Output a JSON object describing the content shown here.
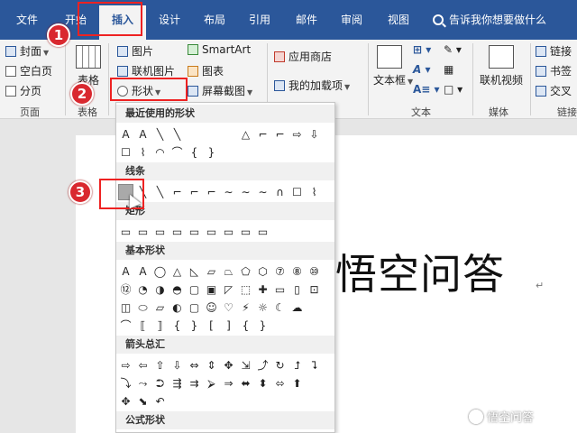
{
  "tabs": [
    {
      "label": "文件"
    },
    {
      "label": "开始"
    },
    {
      "label": "插入"
    },
    {
      "label": "设计"
    },
    {
      "label": "布局"
    },
    {
      "label": "引用"
    },
    {
      "label": "邮件"
    },
    {
      "label": "审阅"
    },
    {
      "label": "视图"
    }
  ],
  "tell_me": "告诉我你想要做什么",
  "ribbon": {
    "pages_group": {
      "cover": "封面",
      "blank": "空白页",
      "break": "分页",
      "label": "页面"
    },
    "table_group": {
      "table": "表格",
      "label": "表格"
    },
    "illustrations": {
      "picture": "图片",
      "online_picture": "联机图片",
      "shapes": "形状",
      "smartart": "SmartArt",
      "chart": "图表",
      "screenshot": "屏幕截图"
    },
    "addins": {
      "store": "应用商店",
      "my_addins": "我的加载项"
    },
    "text_group": {
      "textbox": "文本框",
      "label": "文本"
    },
    "media": {
      "online_video": "联机视频",
      "label": "媒体"
    },
    "links": {
      "link": "链接",
      "bookmark": "书签",
      "cross_ref": "交叉",
      "label": "链接"
    }
  },
  "dropdown": {
    "recent": "最近使用的形状",
    "lines": "线条",
    "rect": "矩形",
    "basic": "基本形状",
    "arrows": "箭头总汇",
    "equation": "公式形状"
  },
  "document": {
    "text": "悟空问答",
    "para_mark": "↵"
  },
  "watermark": "悟空问答",
  "badges": {
    "b1": "1",
    "b2": "2",
    "b3": "3"
  },
  "shape_glyphs": {
    "recent_row1": [
      "A",
      "A",
      "╲",
      "╲",
      "",
      "",
      "",
      "△",
      "⌐",
      "⌐",
      "⇨",
      "⇩"
    ],
    "recent_row2": [
      "☐",
      "⌇",
      "◠",
      "⌒",
      "{",
      "}"
    ],
    "lines_row": [
      "",
      "╲",
      "╲",
      "⌐",
      "⌐",
      "⌐",
      "∼",
      "∼",
      "∼",
      "∩",
      "☐",
      "⌇"
    ],
    "rect_row": [
      "▭",
      "▭",
      "▭",
      "▭",
      "▭",
      "▭",
      "▭",
      "▭",
      "▭"
    ],
    "basic_row1": [
      "A",
      "A",
      "◯",
      "△",
      "◺",
      "▱",
      "⏢",
      "⬠",
      "⬡",
      "⑦",
      "⑧",
      "⑩"
    ],
    "basic_row2": [
      "⑫",
      "◔",
      "◑",
      "◓",
      "▢",
      "▣",
      "◸",
      "⬚",
      "✚",
      "▭",
      "▯",
      "⊡"
    ],
    "basic_row3": [
      "◫",
      "⬭",
      "▱",
      "◐",
      "▢",
      "☺",
      "♡",
      "⚡",
      "☼",
      "☾",
      "☁"
    ],
    "basic_row4": [
      "⌒",
      "⟦",
      "⟧",
      "{",
      "}",
      "[",
      "]",
      "{",
      "}"
    ],
    "arrow_row1": [
      "⇨",
      "⇦",
      "⇧",
      "⇩",
      "⇔",
      "⇕",
      "✥",
      "⇲",
      "⤴",
      "↻",
      "⮥",
      "⮧"
    ],
    "arrow_row2": [
      "⤵",
      "⤳",
      "⮊",
      "⇶",
      "⇉",
      "⮚",
      "⇒",
      "⬌",
      "⬍",
      "⬄",
      "⬆"
    ],
    "arrow_row3": [
      "✥",
      "⬊",
      "↶"
    ]
  }
}
